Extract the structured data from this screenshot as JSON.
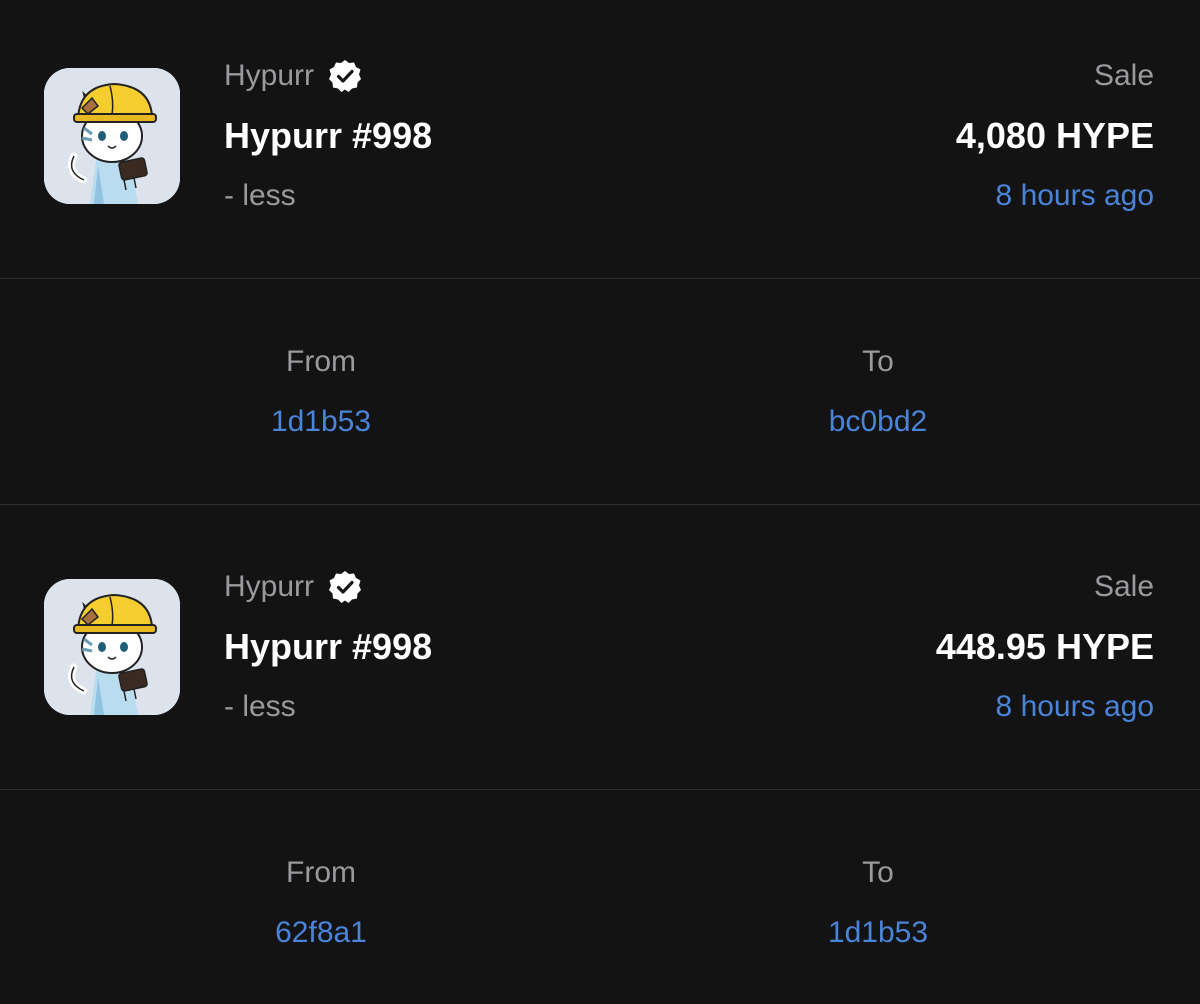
{
  "activity": [
    {
      "collection": "Hypurr",
      "item_name": "Hypurr #998",
      "trait": "- less",
      "event_type": "Sale",
      "price": "4,080 HYPE",
      "time": "8 hours ago",
      "from_label": "From",
      "from_address": "1d1b53",
      "to_label": "To",
      "to_address": "bc0bd2"
    },
    {
      "collection": "Hypurr",
      "item_name": "Hypurr #998",
      "trait": "- less",
      "event_type": "Sale",
      "price": "448.95 HYPE",
      "time": "8 hours ago",
      "from_label": "From",
      "from_address": "62f8a1",
      "to_label": "To",
      "to_address": "1d1b53"
    }
  ],
  "colors": {
    "background": "#131314",
    "link": "#4a84d8",
    "muted": "#9a9a9e",
    "primary_text": "#ffffff"
  },
  "icons": {
    "verified": "verified-badge-icon",
    "thumbnail": "hypurr-cat-nft-image"
  }
}
